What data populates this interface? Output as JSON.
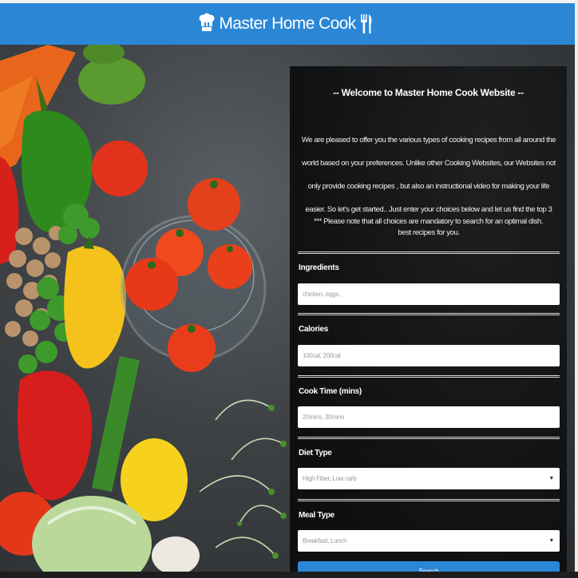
{
  "header": {
    "brand_text": "Master Home Cook"
  },
  "panel": {
    "welcome_title": "-- Welcome to Master Home Cook Website --",
    "intro_text": "We are pleased to offer you the various types of cooking recipes from all around the world based on your preferences. Unlike other Cooking Websites, our Websites not only provide cooking recipes , but also an instructional video for making your life easier. So let's get started.. Just enter your choices below and let us find the top 3 best recipes for you.",
    "note_text": "*** Please note that all choices are mandatory to search for an optimal dish.",
    "fields": {
      "ingredients": {
        "label": "Ingredients",
        "placeholder": "chicken, eggs,"
      },
      "calories": {
        "label": "Calories",
        "placeholder": "100cal, 200cal"
      },
      "cook_time": {
        "label": "Cook Time (mins)",
        "placeholder": "20mins, 30mins"
      },
      "diet_type": {
        "label": "Diet Type",
        "selected": "High Fiber, Low carb"
      },
      "meal_type": {
        "label": "Meal Type",
        "selected": "Breakfast, Lunch"
      }
    },
    "search_label": "Search"
  },
  "colors": {
    "brand_blue": "#2b87d6",
    "panel_bg": "#121314"
  },
  "icons": [
    "chef-hat-icon",
    "fork-knife-icon",
    "dropdown-caret-icon"
  ]
}
